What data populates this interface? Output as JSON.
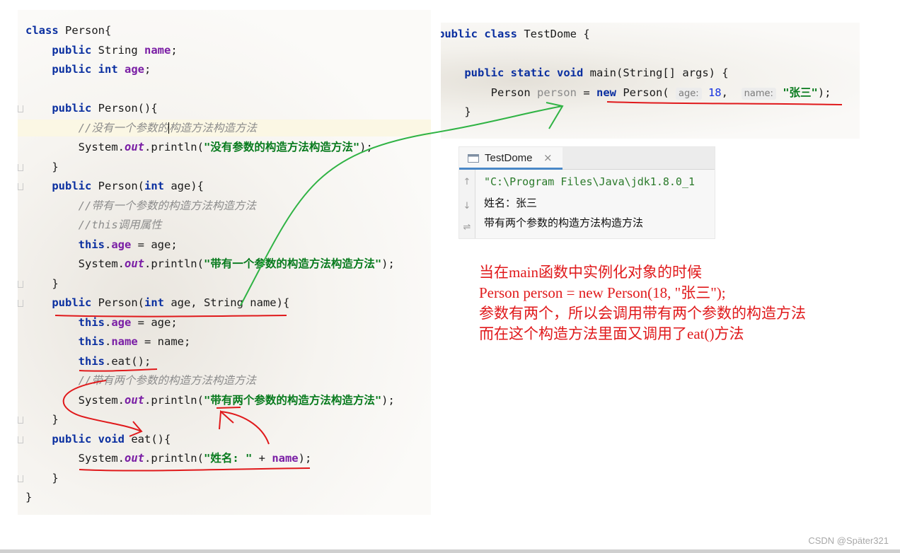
{
  "editor_left": {
    "lines": [
      [
        {
          "t": "class",
          "c": "kw"
        },
        {
          "t": " Person{"
        }
      ],
      [
        {
          "t": "    "
        },
        {
          "t": "public",
          "c": "kw"
        },
        {
          "t": " String "
        },
        {
          "t": "name",
          "c": "fld"
        },
        {
          "t": ";"
        }
      ],
      [
        {
          "t": "    "
        },
        {
          "t": "public",
          "c": "kw"
        },
        {
          "t": " "
        },
        {
          "t": "int",
          "c": "kw"
        },
        {
          "t": " "
        },
        {
          "t": "age",
          "c": "fld"
        },
        {
          "t": ";"
        }
      ],
      [],
      [
        {
          "t": "    "
        },
        {
          "t": "public",
          "c": "kw"
        },
        {
          "t": " Person(){"
        }
      ],
      [
        {
          "t": "        "
        },
        {
          "t": "//没有一个参数的",
          "c": "cmt"
        },
        {
          "caret": true
        },
        {
          "t": "构造方法构造方法",
          "c": "cmt"
        }
      ],
      [
        {
          "t": "        System."
        },
        {
          "t": "out",
          "c": "st"
        },
        {
          "t": ".println("
        },
        {
          "t": "\"没有参数的构造方法构造方法\"",
          "c": "str"
        },
        {
          "t": ");"
        }
      ],
      [
        {
          "t": "    }"
        }
      ],
      [
        {
          "t": "    "
        },
        {
          "t": "public",
          "c": "kw"
        },
        {
          "t": " Person("
        },
        {
          "t": "int",
          "c": "kw"
        },
        {
          "t": " age){"
        }
      ],
      [
        {
          "t": "        "
        },
        {
          "t": "//带有一个参数的构造方法构造方法",
          "c": "cmt"
        }
      ],
      [
        {
          "t": "        "
        },
        {
          "t": "//this调用属性",
          "c": "cmt"
        }
      ],
      [
        {
          "t": "        "
        },
        {
          "t": "this",
          "c": "kw"
        },
        {
          "t": "."
        },
        {
          "t": "age",
          "c": "fld"
        },
        {
          "t": " = age;"
        }
      ],
      [
        {
          "t": "        System."
        },
        {
          "t": "out",
          "c": "st"
        },
        {
          "t": ".println("
        },
        {
          "t": "\"带有一个参数的构造方法构造方法\"",
          "c": "str"
        },
        {
          "t": ");"
        }
      ],
      [
        {
          "t": "    }"
        }
      ],
      [
        {
          "t": "    "
        },
        {
          "t": "public",
          "c": "kw"
        },
        {
          "t": " Person("
        },
        {
          "t": "int",
          "c": "kw"
        },
        {
          "t": " age, String name){"
        }
      ],
      [
        {
          "t": "        "
        },
        {
          "t": "this",
          "c": "kw"
        },
        {
          "t": "."
        },
        {
          "t": "age",
          "c": "fld"
        },
        {
          "t": " = age;"
        }
      ],
      [
        {
          "t": "        "
        },
        {
          "t": "this",
          "c": "kw"
        },
        {
          "t": "."
        },
        {
          "t": "name",
          "c": "fld"
        },
        {
          "t": " = name;"
        }
      ],
      [
        {
          "t": "        "
        },
        {
          "t": "this",
          "c": "kw"
        },
        {
          "t": ".eat();"
        }
      ],
      [
        {
          "t": "        "
        },
        {
          "t": "//带有两个参数的构造方法构造方法",
          "c": "cmt"
        }
      ],
      [
        {
          "t": "        System."
        },
        {
          "t": "out",
          "c": "st"
        },
        {
          "t": ".println("
        },
        {
          "t": "\"带有两个参数的构造方法构造方法\"",
          "c": "str"
        },
        {
          "t": ");"
        }
      ],
      [
        {
          "t": "    }"
        }
      ],
      [
        {
          "t": "    "
        },
        {
          "t": "public",
          "c": "kw"
        },
        {
          "t": " "
        },
        {
          "t": "void",
          "c": "kw"
        },
        {
          "t": " eat(){"
        }
      ],
      [
        {
          "t": "        System."
        },
        {
          "t": "out",
          "c": "st"
        },
        {
          "t": ".println("
        },
        {
          "t": "\"姓名: \"",
          "c": "str"
        },
        {
          "t": " + "
        },
        {
          "t": "name",
          "c": "fld"
        },
        {
          "t": ");"
        }
      ],
      [
        {
          "t": "    }"
        }
      ],
      [
        {
          "t": "}"
        }
      ]
    ],
    "highlight_line": 5
  },
  "editor_right": {
    "lines": [
      [
        {
          "t": "public",
          "c": "kw"
        },
        {
          "t": " "
        },
        {
          "t": "class",
          "c": "kw"
        },
        {
          "t": " TestDome {"
        }
      ],
      [],
      [
        {
          "t": "    "
        },
        {
          "t": "public",
          "c": "kw"
        },
        {
          "t": " "
        },
        {
          "t": "static",
          "c": "kw"
        },
        {
          "t": " "
        },
        {
          "t": "void",
          "c": "kw"
        },
        {
          "t": " main(String[] args) {"
        }
      ],
      [
        {
          "t": "        Person "
        },
        {
          "t": "person",
          "c": "gray"
        },
        {
          "t": " = "
        },
        {
          "t": "new",
          "c": "kw"
        },
        {
          "t": " Person( "
        },
        {
          "t": "age:",
          "c": "hint"
        },
        {
          "t": " "
        },
        {
          "t": "18",
          "c": "num"
        },
        {
          "t": ",  "
        },
        {
          "t": "name:",
          "c": "hint"
        },
        {
          "t": " "
        },
        {
          "t": "\"张三\"",
          "c": "str"
        },
        {
          "t": ");"
        }
      ],
      [
        {
          "t": "    }"
        }
      ]
    ]
  },
  "console": {
    "tab_label": "TestDome",
    "close_glyph": "×",
    "lines": [
      {
        "text": "\"C:\\Program Files\\Java\\jdk1.8.0_1",
        "c": "cmd"
      },
      {
        "text": "姓名：张三",
        "c": "out"
      },
      {
        "text": "带有两个参数的构造方法构造方法",
        "c": "out"
      }
    ],
    "side_icons": [
      "↑",
      "↓",
      "⇌"
    ]
  },
  "annotation": {
    "lines": [
      "当在main函数中实例化对象的时候",
      "Person person = new Person(18, \"张三\");",
      "参数有两个，所以会调用带有两个参数的构造方法",
      "而在这个构造方法里面又调用了eat()方法"
    ],
    "color": "#e0191b"
  },
  "watermark": "CSDN @Später321"
}
